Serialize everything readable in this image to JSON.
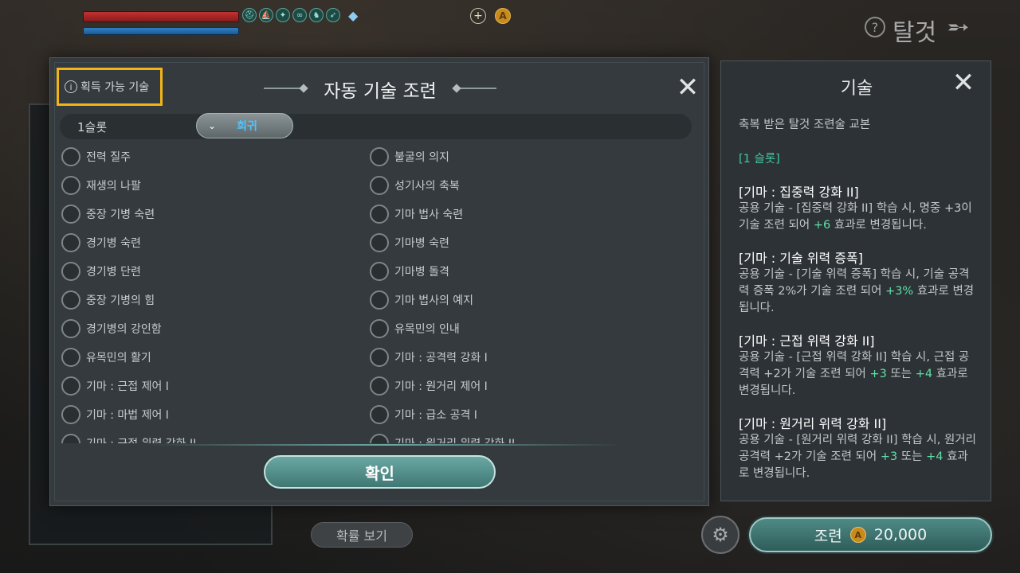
{
  "hud": {
    "buff_icons": [
      "helm-icon",
      "ship-icon",
      "wing-icon",
      "horseshoe-icon",
      "pegasus-icon",
      "feather-icon"
    ],
    "mount_title": "탈것"
  },
  "dialog": {
    "available_label": "획득 가능 기술",
    "title": "자동 기술 조련",
    "slot_label": "1슬롯",
    "rarity": "희귀",
    "left_skills": [
      "전력 질주",
      "재생의 나팔",
      "중장 기병 숙련",
      "경기병 숙련",
      "경기병 단련",
      "중장 기병의 힘",
      "경기병의 강인함",
      "유목민의 활기",
      "기마 : 근접 제어 I",
      "기마 : 마법 제어 I",
      "기마 : 근접 위력 강화 II"
    ],
    "right_skills": [
      "불굴의 의지",
      "성기사의 축복",
      "기마 법사 숙련",
      "기마병 숙련",
      "기마병 돌격",
      "기마 법사의 예지",
      "유목민의 인내",
      "기마 : 공격력 강화 I",
      "기마 : 원거리 제어 I",
      "기마 : 급소 공격 I",
      "기마 : 원거리 위력 강화 II"
    ],
    "confirm_label": "확인"
  },
  "panel": {
    "title": "기술",
    "subtitle": "축복 받은 탈것 조련술 교본",
    "slot": "[1 슬롯]",
    "items": [
      {
        "name": "[기마 : 집중력 강화 II]",
        "pre": "공용 기술 - [집중력 강화 II] 학습 시, 명중 +3이 기술 조련 되어 ",
        "hl": "+6",
        "post": " 효과로 변경됩니다."
      },
      {
        "name": "[기마 : 기술 위력 증폭]",
        "pre": "공용 기술 - [기술 위력 증폭] 학습 시, 기술 공격력 증폭 2%가 기술 조련 되어 ",
        "hl": "+3%",
        "post": " 효과로 변경됩니다."
      },
      {
        "name": "[기마 : 근접 위력 강화 II]",
        "pre": "공용 기술 - [근접 위력 강화 II] 학습 시, 근접 공격력 +2가 기술 조련 되어 ",
        "hl": "+3",
        "mid": " 또는 ",
        "hl2": "+4",
        "post": " 효과로 변경됩니다."
      },
      {
        "name": "[기마 : 원거리 위력 강화 II]",
        "pre": "공용 기술 - [원거리 위력 강화 II] 학습 시, 원거리 공격력 +2가 기술 조련 되어 ",
        "hl": "+3",
        "mid": " 또는 ",
        "hl2": "+4",
        "post": " 효과로 변경됩니다."
      }
    ]
  },
  "bottom": {
    "probability_label": "확률 보기",
    "train_label": "조련",
    "train_cost": "20,000"
  }
}
